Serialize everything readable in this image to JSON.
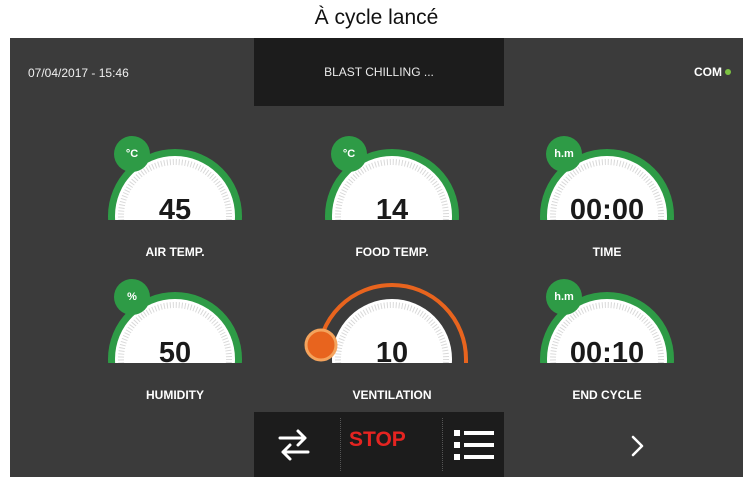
{
  "caption": "À cycle lancé",
  "header": {
    "datetime": "07/04/2017 - 15:46",
    "status": "BLAST CHILLING ...",
    "com_label": "COM"
  },
  "gauges": [
    {
      "label": "AIR TEMP.",
      "value": "45",
      "unit": "°C"
    },
    {
      "label": "FOOD TEMP.",
      "value": "14",
      "unit": "°C"
    },
    {
      "label": "TIME",
      "value": "00:00",
      "unit": "h.m"
    },
    {
      "label": "HUMIDITY",
      "value": "50",
      "unit": "%"
    },
    {
      "label": "VENTILATION",
      "value": "10",
      "unit": ""
    },
    {
      "label": "END CYCLE",
      "value": "00:10",
      "unit": "h.m"
    }
  ],
  "footer": {
    "stop_label": "STOP",
    "swap_icon": "swap-arrows-icon",
    "menu_icon": "list-menu-icon",
    "next_icon": "chevron-right-icon"
  },
  "colors": {
    "panel_bg": "#3b3b3b",
    "bar_bg": "#1c1c1c",
    "gauge_green": "#2e9b46",
    "ventilation_orange": "#e8641e",
    "stop_red": "#e52421",
    "com_dot": "#7cc242"
  }
}
